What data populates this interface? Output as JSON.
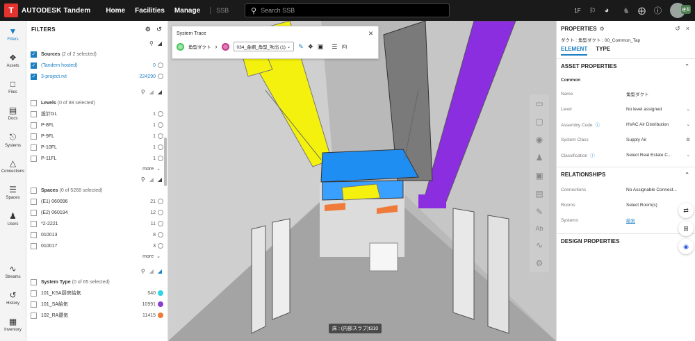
{
  "topbar": {
    "logo": "T",
    "brand": "AUTODESK Tandem",
    "nav": [
      "Home",
      "Facilities",
      "Manage"
    ],
    "crumb": "SSB",
    "search_placeholder": "Search SSB",
    "floor_label": "1F",
    "avatar_label": "建吾"
  },
  "rail": [
    {
      "label": "Filters",
      "icon": "filter-icon"
    },
    {
      "label": "Assets",
      "icon": "tag-icon"
    },
    {
      "label": "Files",
      "icon": "folder-icon"
    },
    {
      "label": "Docs",
      "icon": "docs-icon"
    },
    {
      "label": "Systems",
      "icon": "systems-icon"
    },
    {
      "label": "Connections",
      "icon": "connections-icon"
    },
    {
      "label": "Spaces",
      "icon": "layers-icon"
    },
    {
      "label": "Users",
      "icon": "users-icon"
    },
    {
      "label": "Streams",
      "icon": "streams-icon"
    },
    {
      "label": "History",
      "icon": "history-icon"
    },
    {
      "label": "Inventory",
      "icon": "grid-icon"
    }
  ],
  "filters": {
    "title": "FILTERS",
    "sources": {
      "title": "Sources",
      "summary": "(2 of 2 selected)",
      "items": [
        {
          "name": "(Tandem hosted)",
          "count": "0"
        },
        {
          "name": "3-project.rvt",
          "count": "224290"
        }
      ]
    },
    "levels": {
      "title": "Levels",
      "summary": "(0 of 88 selected)",
      "items": [
        {
          "name": "設計GL",
          "count": "1"
        },
        {
          "name": "P-8FL",
          "count": "1"
        },
        {
          "name": "P-9FL",
          "count": "1"
        },
        {
          "name": "P-10FL",
          "count": "1"
        },
        {
          "name": "P-11FL",
          "count": "1"
        }
      ]
    },
    "spaces": {
      "title": "Spaces",
      "summary": "(0 of 5268 selected)",
      "items": [
        {
          "name": "(E1) 060096",
          "count": "21"
        },
        {
          "name": "(E2) 060194",
          "count": "12"
        },
        {
          "name": "*2-2221",
          "count": "11"
        },
        {
          "name": "010013",
          "count": "8"
        },
        {
          "name": "010017",
          "count": "3"
        }
      ]
    },
    "system_type": {
      "title": "System Type",
      "summary": "(0 of 65 selected)",
      "items": [
        {
          "name": "101_KSA厨房給気",
          "count": "540",
          "color": "#33d3e6"
        },
        {
          "name": "101_SA給気",
          "count": "10991",
          "color": "#8a3fd1"
        },
        {
          "name": "102_RA還気",
          "count": "11415",
          "color": "#f07a3a"
        }
      ]
    },
    "more_label": "more"
  },
  "trace": {
    "title": "System Trace",
    "from": "角型ダクト",
    "to": "034_金網_角型_吹出 (1)",
    "count": "(0)"
  },
  "viewport": {
    "floor_tooltip": "床 : (内部スラブ)t310"
  },
  "properties": {
    "title": "PROPERTIES",
    "subtitle": "ダクト : 角型ダクト : 00_Common_Tap",
    "tabs": [
      "ELEMENT",
      "TYPE"
    ],
    "asset_section": "ASSET PROPERTIES",
    "group": "Common",
    "rows": [
      {
        "k": "Name",
        "v": "角型ダクト"
      },
      {
        "k": "Level",
        "v": "No level assigned"
      },
      {
        "k": "Assembly Code",
        "v": "HVAC Air Distribution"
      },
      {
        "k": "System Class",
        "v": "Supply Air"
      },
      {
        "k": "Classification",
        "v": "Select Real Estate C..."
      }
    ],
    "relationships": "RELATIONSHIPS",
    "rel_rows": [
      {
        "k": "Connections",
        "v": "No Assignable Connect..."
      },
      {
        "k": "Rooms",
        "v": "Select Room(s)"
      },
      {
        "k": "Systems",
        "v": "給気"
      }
    ],
    "design": "DESIGN PROPERTIES"
  }
}
